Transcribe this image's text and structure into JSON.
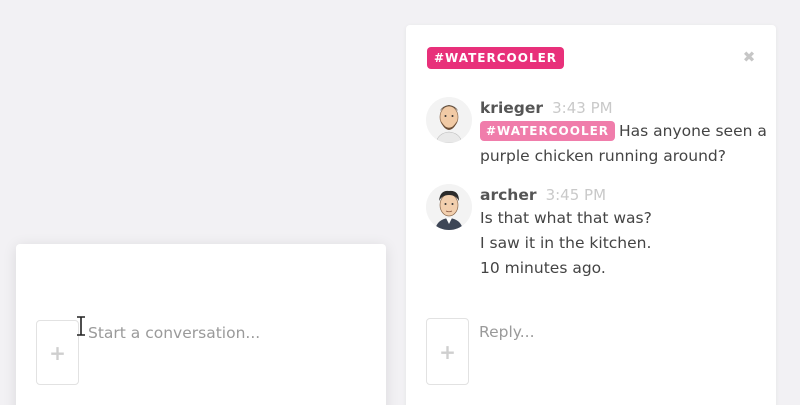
{
  "compose": {
    "placeholder": "Start a conversation...",
    "attach_icon": "+"
  },
  "conversation": {
    "channel_tag": "#WATERCOOLER",
    "close_icon": "✖",
    "messages": [
      {
        "author": "krieger",
        "time": "3:43 PM",
        "avatar": "krieger-avatar",
        "tag": "#WATERCOOLER",
        "lines": [
          "Has anyone seen a",
          "purple chicken running around?"
        ]
      },
      {
        "author": "archer",
        "time": "3:45 PM",
        "avatar": "archer-avatar",
        "lines": [
          "Is that what that was?",
          "I saw it in the kitchen.",
          "10 minutes ago."
        ]
      }
    ],
    "reply_placeholder": "Reply...",
    "attach_icon": "+"
  },
  "colors": {
    "background": "#f2f1f4",
    "channel_tag": "#e8307a",
    "inline_tag": "#f07dab"
  }
}
